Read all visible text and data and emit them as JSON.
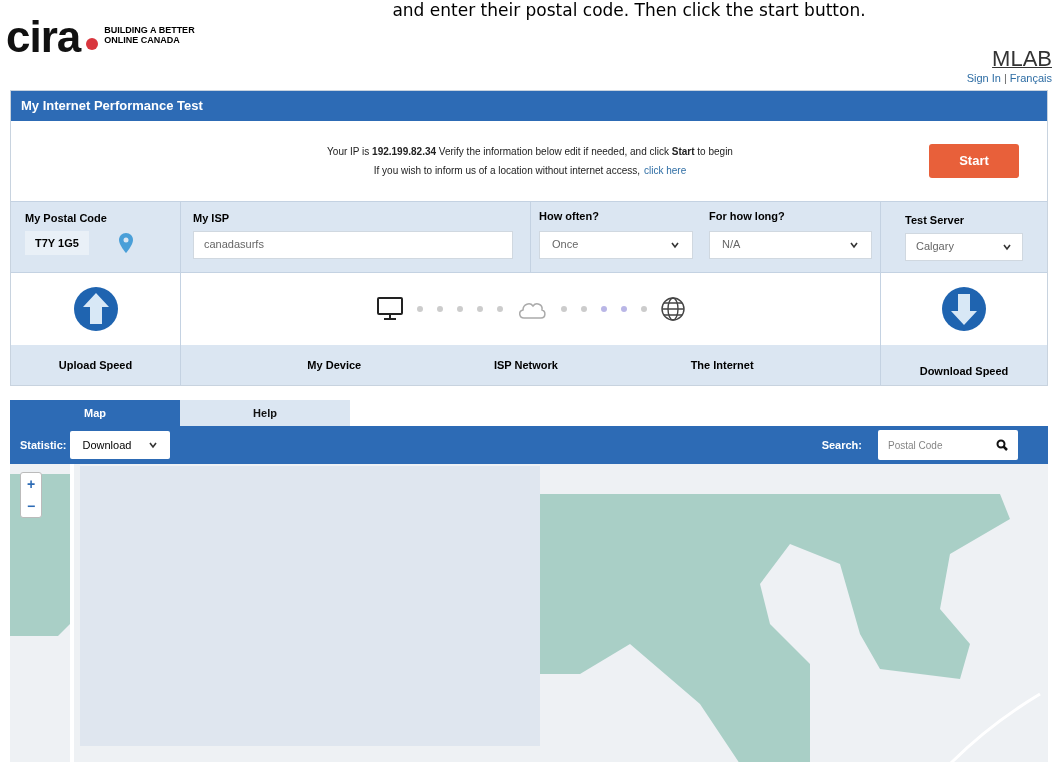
{
  "instruction": "and enter their postal code. Then click the start button.",
  "brand": {
    "logo": "cira",
    "tagline": "BUILDING A BETTER ONLINE CANADA"
  },
  "partner": "MLAB",
  "account_links": [
    {
      "label": "Sign In"
    },
    {
      "label": "Français"
    }
  ],
  "link_separator": "|",
  "title": "My Internet Performance Test",
  "info": {
    "line1": "Your IP is **192.199.82.34** Verify the information below edit if needed, and click **Start** to begin",
    "line2": "If you wish to inform us of a location without internet access,",
    "link": "click here"
  },
  "start_button": "Start",
  "postal": {
    "label": "My Postal Code",
    "value": "T7Y 1G5"
  },
  "isp": {
    "label": "My ISP",
    "value": "canadasurfs"
  },
  "selects": [
    {
      "label": "How often?",
      "value": "Once"
    },
    {
      "label": "For how long?",
      "value": "N/A"
    }
  ],
  "server": {
    "label": "Test Server",
    "value": "Calgary"
  },
  "upload_label": "Upload Speed",
  "path_labels": [
    "My Device",
    "ISP Network",
    "The Internet"
  ],
  "download_label": "Download Speed",
  "tabs": [
    {
      "label": "Map",
      "selected": true
    },
    {
      "label": "Help",
      "selected": false
    }
  ],
  "statistic": {
    "label": "Statistic:",
    "value": "Download"
  },
  "search": {
    "label": "Search:",
    "placeholder": "Postal Code"
  },
  "zoom_controls": [
    "+",
    "−"
  ]
}
